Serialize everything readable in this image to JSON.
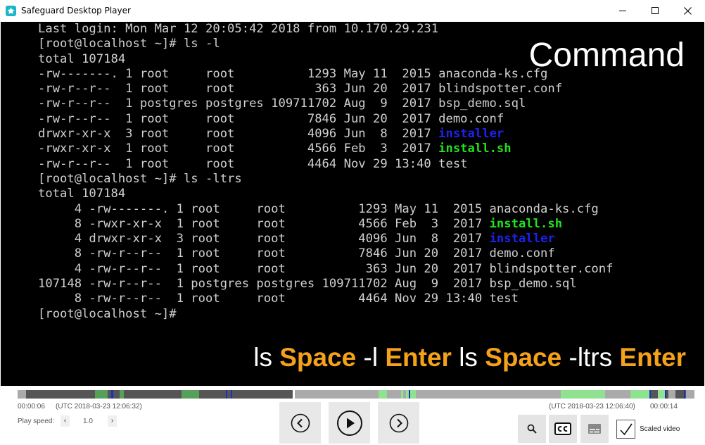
{
  "window": {
    "title": "Safeguard Desktop Player",
    "app_icon": "safeguard-logo-icon",
    "minimize_icon": "minimize-icon",
    "maximize_icon": "maximize-icon",
    "close_icon": "close-icon"
  },
  "terminal": {
    "lines": [
      [
        {
          "t": "Last login: Mon Mar 12 20:05:42 2018 from 10.170.29.231"
        }
      ],
      [
        {
          "t": "[root@localhost ~]# ls -l"
        }
      ],
      [
        {
          "t": "total 107184"
        }
      ],
      [
        {
          "t": "-rw-------. 1 root     root          1293 May 11  2015 anaconda-ks.cfg"
        }
      ],
      [
        {
          "t": "-rw-r--r--  1 root     root           363 Jun 20  2017 blindspotter.conf"
        }
      ],
      [
        {
          "t": "-rw-r--r--  1 postgres postgres 109711702 Aug  9  2017 bsp_demo.sql"
        }
      ],
      [
        {
          "t": "-rw-r--r--  1 root     root          7846 Jun 20  2017 demo.conf"
        }
      ],
      [
        {
          "t": "drwxr-xr-x  3 root     root          4096 Jun  8  2017 "
        },
        {
          "t": "installer",
          "c": "blue"
        }
      ],
      [
        {
          "t": "-rwxr-xr-x  1 root     root          4566 Feb  3  2017 "
        },
        {
          "t": "install.sh",
          "c": "green"
        }
      ],
      [
        {
          "t": "-rw-r--r--  1 root     root          4464 Nov 29 13:40 test"
        }
      ],
      [
        {
          "t": "[root@localhost ~]# ls -ltrs"
        }
      ],
      [
        {
          "t": "total 107184"
        }
      ],
      [
        {
          "t": "     4 -rw-------. 1 root     root          1293 May 11  2015 anaconda-ks.cfg"
        }
      ],
      [
        {
          "t": "     8 -rwxr-xr-x  1 root     root          4566 Feb  3  2017 "
        },
        {
          "t": "install.sh",
          "c": "green"
        }
      ],
      [
        {
          "t": "     4 drwxr-xr-x  3 root     root          4096 Jun  8  2017 "
        },
        {
          "t": "installer",
          "c": "blue"
        }
      ],
      [
        {
          "t": "     8 -rw-r--r--  1 root     root          7846 Jun 20  2017 demo.conf"
        }
      ],
      [
        {
          "t": "     4 -rw-r--r--  1 root     root           363 Jun 20  2017 blindspotter.conf"
        }
      ],
      [
        {
          "t": "107148 -rw-r--r--  1 postgres postgres 109711702 Aug  9  2017 bsp_demo.sql"
        }
      ],
      [
        {
          "t": "     8 -rw-r--r--  1 root     root          4464 Nov 29 13:40 test"
        }
      ],
      [
        {
          "t": "[root@localhost ~]#"
        }
      ]
    ],
    "overlay_title": "Command",
    "caption": [
      {
        "t": "ls ",
        "key": false
      },
      {
        "t": "Space",
        "key": true
      },
      {
        "t": " -l ",
        "key": false
      },
      {
        "t": "Enter",
        "key": true
      },
      {
        "t": " ls ",
        "key": false
      },
      {
        "t": "Space",
        "key": true
      },
      {
        "t": " -ltrs ",
        "key": false
      },
      {
        "t": "Enter",
        "key": true
      }
    ]
  },
  "player": {
    "time_start": "00:00:06",
    "time_start_utc": "(UTC 2018-03-23 12:06:32)",
    "time_end_utc": "(UTC 2018-03-23 12:06:40)",
    "time_end": "00:00:14",
    "speed_label": "Play speed:",
    "speed_dec": "‹",
    "speed_value": "1.0",
    "speed_inc": "›",
    "prev_icon": "previous-icon",
    "play_icon": "play-icon",
    "next_icon": "next-icon",
    "search_icon": "search-icon",
    "cc_icon": "closed-captions-icon",
    "subtitles_icon": "subtitles-icon",
    "scaled_video_checked": true,
    "scaled_video_label": "Scaled video",
    "colors": {
      "timeline_base": "#555555",
      "timeline_light": "#aaaaaa",
      "timeline_green": "#56a05a",
      "timeline_brightgreen": "#8fe28f",
      "timeline_marker": "#1a2fc8",
      "caption_key": "#f5a11a"
    }
  }
}
